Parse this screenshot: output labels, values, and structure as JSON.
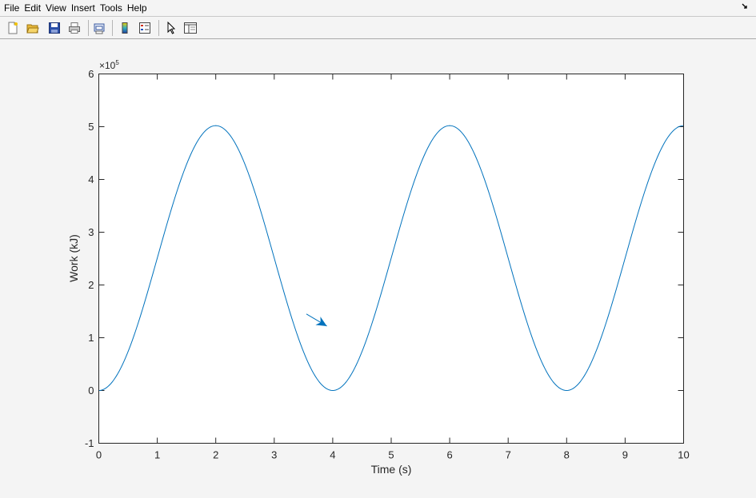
{
  "menu": {
    "items": [
      "File",
      "Edit",
      "View",
      "Insert",
      "Tools",
      "Help"
    ],
    "dock_icon": "undock-arrow-icon"
  },
  "toolbar": {
    "buttons": [
      "new-figure-icon",
      "open-file-icon",
      "save-icon",
      "print-icon",
      "print-preview-icon",
      "insert-colorbar-icon",
      "insert-legend-icon",
      "edit-plot-arrow-icon",
      "show-plot-tools-icon"
    ]
  },
  "chart_data": {
    "type": "line",
    "xlabel": "Time (s)",
    "ylabel": "Work (kJ)",
    "exponent_label": "×10",
    "exponent_power": "5",
    "xlim": [
      0,
      10
    ],
    "ylim": [
      -100000,
      600000
    ],
    "xticks": [
      "0",
      "1",
      "2",
      "3",
      "4",
      "5",
      "6",
      "7",
      "8",
      "9",
      "10"
    ],
    "yticks": [
      "-1",
      "0",
      "1",
      "2",
      "3",
      "4",
      "5",
      "6"
    ],
    "series": [
      {
        "color": "#0072bd",
        "formula": "y = 251000 * (1 - cos(pi * x / 2))",
        "x": [
          0,
          0.5,
          1,
          1.5,
          2,
          2.5,
          3,
          3.5,
          4,
          4.5,
          5,
          5.5,
          6,
          6.5,
          7,
          7.5,
          8,
          8.5,
          9,
          9.5,
          10
        ],
        "y": [
          0,
          73500,
          251000,
          428500,
          502000,
          428500,
          251000,
          73500,
          0,
          73500,
          251000,
          428500,
          502000,
          428500,
          251000,
          73500,
          0,
          73500,
          251000,
          428500,
          502000
        ]
      }
    ],
    "annotations": [
      {
        "type": "arrow",
        "x_start": 3.55,
        "y_start": 145000,
        "x_end": 3.9,
        "y_end": 122000,
        "color": "#0072bd"
      }
    ],
    "grid": false,
    "box": true
  }
}
